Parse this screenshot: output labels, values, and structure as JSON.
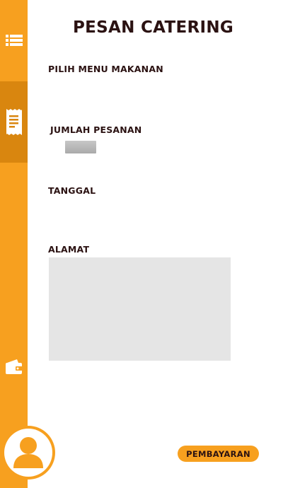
{
  "header": {
    "title": "PESAN CATERING"
  },
  "form": {
    "menu_label": "PILIH MENU MAKANAN",
    "quantity_label": "JUMLAH PESANAN",
    "date_label": "TANGGAL",
    "address_label": "ALAMAT"
  },
  "actions": {
    "pay_label": "PEMBAYARAN"
  },
  "sidebar": {
    "items": [
      {
        "icon": "list-icon"
      },
      {
        "icon": "receipt-icon",
        "active": true
      },
      {
        "icon": "wallet-icon"
      }
    ]
  },
  "colors": {
    "accent": "#f7a01f",
    "accent_active": "#d9860f",
    "text": "#2b1212",
    "field_bg": "#e5e5e5"
  }
}
